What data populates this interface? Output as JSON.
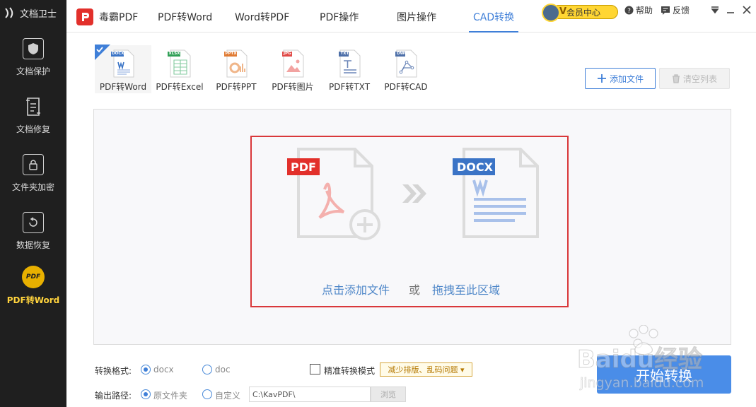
{
  "sidebar": {
    "title": "文档卫士",
    "items": [
      {
        "label": "文档保护",
        "icon": "shield-icon"
      },
      {
        "label": "文档修复",
        "icon": "repair-doc-icon"
      },
      {
        "label": "文件夹加密",
        "icon": "lock-folder-icon"
      },
      {
        "label": "数据恢复",
        "icon": "restore-icon"
      },
      {
        "label": "PDF转Word",
        "icon": "pdf-coin-icon",
        "badge": "PDF"
      }
    ]
  },
  "header": {
    "app_name": "毒霸PDF",
    "tabs": [
      {
        "label": "PDF转Word"
      },
      {
        "label": "Word转PDF"
      },
      {
        "label": "PDF操作"
      },
      {
        "label": "图片操作"
      },
      {
        "label": "CAD转换"
      }
    ],
    "member_label": "会员中心",
    "help_label": "帮助",
    "feedback_label": "反馈"
  },
  "formats": [
    {
      "label": "PDF转Word",
      "tag": "DOCX",
      "color": "#3b74c6"
    },
    {
      "label": "PDF转Excel",
      "tag": "XLSX",
      "color": "#2e9f55"
    },
    {
      "label": "PDF转PPT",
      "tag": "PPTX",
      "color": "#e07b34"
    },
    {
      "label": "PDF转图片",
      "tag": "JPG",
      "color": "#e04a47"
    },
    {
      "label": "PDF转TXT",
      "tag": "TXT",
      "color": "#4d6fa8"
    },
    {
      "label": "PDF转CAD",
      "tag": "DWG",
      "color": "#4d6fa8"
    }
  ],
  "toolbar": {
    "add_file": "添加文件",
    "clear_list": "清空列表"
  },
  "dropzone": {
    "src_tag": "PDF",
    "dst_tag": "DOCX",
    "click_add": "点击添加文件",
    "or": "或",
    "drag_here": "拖拽至此区域"
  },
  "options": {
    "format_label": "转换格式:",
    "format_docx": "docx",
    "format_doc": "doc",
    "precise_mode": "精准转换模式",
    "precise_badge": "减少排版、乱码问题 ▾",
    "output_label": "输出路径:",
    "output_original": "原文件夹",
    "output_custom": "自定义",
    "path_value": "C:\\KavPDF\\",
    "browse": "浏览",
    "start": "开始转换"
  },
  "watermark": {
    "brand": "Baidu经验",
    "url": "jingyan.baidu.com"
  },
  "colors": {
    "accent": "#3f7fd8",
    "sidebar_bg": "#1f1f1f",
    "highlight_red": "#d9383a",
    "member_gold": "#ffd633"
  }
}
